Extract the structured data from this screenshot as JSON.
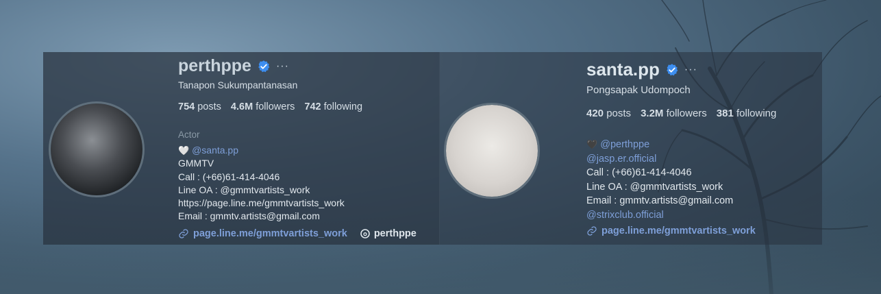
{
  "profiles": [
    {
      "username": "perthppe",
      "more": "···",
      "full_name": "Tanapon Sukumpantanasan",
      "stats": {
        "posts_count": "754",
        "posts_label": "posts",
        "followers_count": "4.6M",
        "followers_label": "followers",
        "following_count": "742",
        "following_label": "following"
      },
      "category": "Actor",
      "bio": {
        "heart": "🤍",
        "mention": "@santa.pp",
        "line2": "GMMTV",
        "line3": "Call : (+66)61-414-4046",
        "line4": "Line OA : @gmmtvartists_work",
        "line5": "https://page.line.me/gmmtvartists_work",
        "line6": "Email : gmmtv.artists@gmail.com"
      },
      "link": "page.line.me/gmmtvartists_work",
      "threads": "perthppe"
    },
    {
      "username": "santa.pp",
      "more": "···",
      "full_name": "Pongsapak Udompoch",
      "stats": {
        "posts_count": "420",
        "posts_label": "posts",
        "followers_count": "3.2M",
        "followers_label": "followers",
        "following_count": "381",
        "following_label": "following"
      },
      "bio": {
        "heart": "🖤",
        "mention": "@perthppe",
        "line2": "@jasp.er.official",
        "line3": "Call : (+66)61-414-4046",
        "line4": "Line OA : @gmmtvartists_work",
        "line5": "Email : gmmtv.artists@gmail.com",
        "line6": "@strixclub.official"
      },
      "link": "page.line.me/gmmtvartists_work"
    }
  ],
  "colors": {
    "link": "#7e9fd8",
    "verified": "#3d8ef0",
    "panel": "#28323e"
  }
}
